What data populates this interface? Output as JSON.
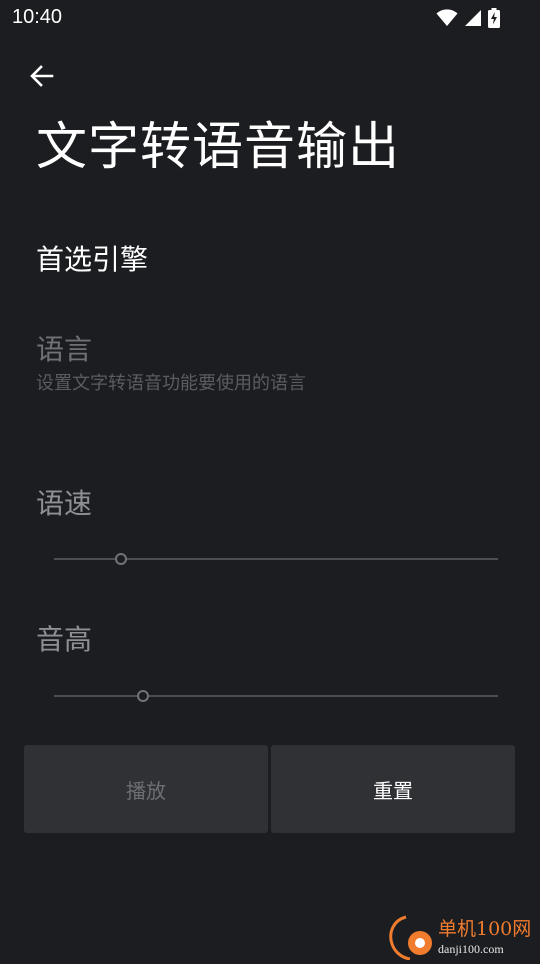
{
  "status_bar": {
    "time": "10:40",
    "icons": [
      "wifi-icon",
      "signal-icon",
      "battery-charging-icon"
    ]
  },
  "header": {
    "back_icon": "arrow-left-icon",
    "title": "文字转语音输出"
  },
  "preferences": {
    "engine": {
      "title": "首选引擎"
    },
    "language": {
      "title": "语言",
      "summary": "设置文字转语音功能要使用的语言"
    }
  },
  "speech_rate": {
    "label": "语速",
    "value_fraction": 0.15
  },
  "pitch": {
    "label": "音高",
    "value_fraction": 0.2
  },
  "buttons": {
    "play_label": "播放",
    "reset_label": "重置"
  },
  "watermark": {
    "name": "单机100网",
    "url": "danji100.com"
  },
  "colors": {
    "background": "#1b1d20",
    "button_bg": "#2f3134",
    "disabled_text": "#6f7275",
    "watermark_orange": "#f07c2e"
  }
}
